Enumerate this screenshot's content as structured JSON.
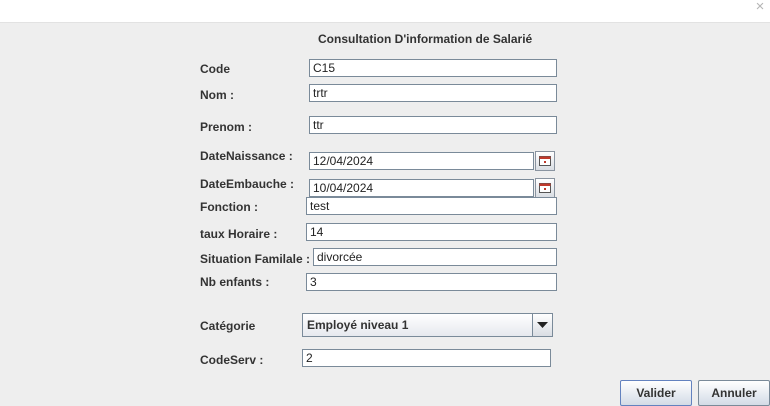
{
  "window": {
    "close_glyph": "×"
  },
  "form": {
    "title": "Consultation D'information de Salarié",
    "fields": {
      "code": {
        "label": "Code",
        "value": "C15"
      },
      "nom": {
        "label": "Nom :",
        "value": "trtr"
      },
      "prenom": {
        "label": "Prenom :",
        "value": "ttr"
      },
      "naissance": {
        "label": "DateNaissance :",
        "value": "12/04/2024"
      },
      "embauche": {
        "label": "DateEmbauche :",
        "value": "10/04/2024"
      },
      "fonction": {
        "label": "Fonction :",
        "value": "test"
      },
      "taux": {
        "label": "taux Horaire :",
        "value": "14"
      },
      "situation": {
        "label": "Situation Familale :",
        "value": "divorcée"
      },
      "enfants": {
        "label": "Nb enfants :",
        "value": "3"
      },
      "categorie": {
        "label": "Catégorie",
        "value": "Employé niveau 1"
      },
      "codeserv": {
        "label": "CodeServ :",
        "value": "2"
      }
    }
  },
  "buttons": {
    "valider": "Valider",
    "annuler": "Annuler"
  },
  "icons": {
    "calendar": "calendar-icon",
    "dropdown": "chevron-down-icon",
    "close": "close-icon"
  },
  "colors": {
    "accent_border": "#6382bf",
    "field_border": "#7a8a99",
    "background": "#eeeeee"
  }
}
